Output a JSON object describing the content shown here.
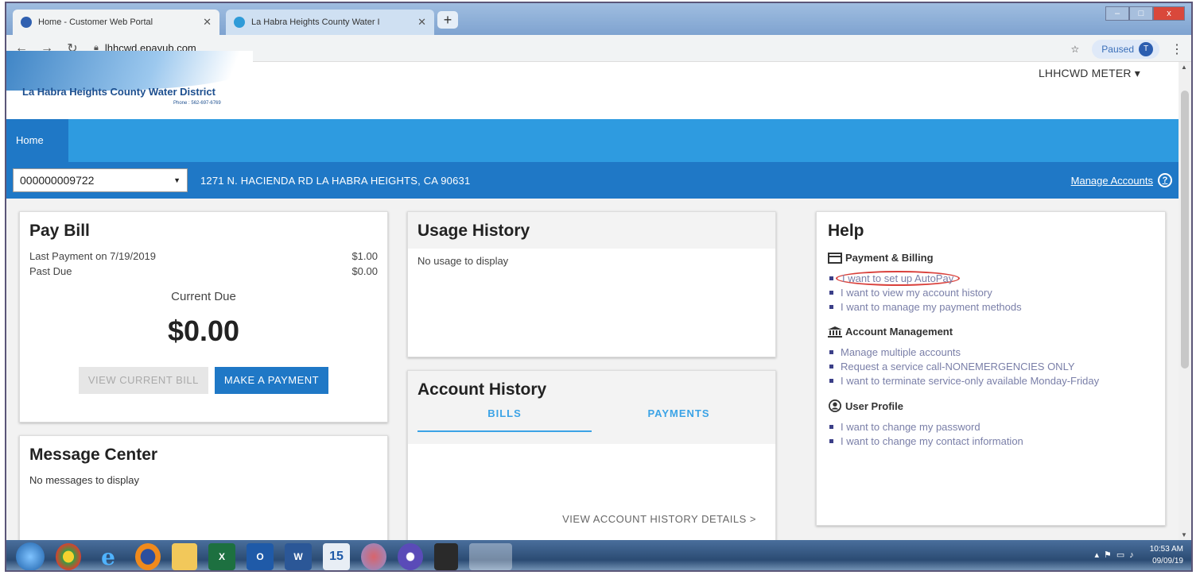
{
  "browser": {
    "tabs": [
      {
        "title": "Home - Customer Web Portal",
        "active": true
      },
      {
        "title": "La Habra Heights County Water I",
        "active": false
      }
    ],
    "new_tab": "+",
    "url": "lhhcwd.epayub.com",
    "profile_status": "Paused",
    "profile_initial": "T",
    "window_buttons": {
      "minimize": "–",
      "maximize": "□",
      "close": "x"
    }
  },
  "header": {
    "logo_title": "La Habra Heights County Water District",
    "logo_phone": "Phone : 562-697-6769",
    "user_menu": "LHHCWD METER ▾"
  },
  "nav": {
    "home": "Home"
  },
  "account_bar": {
    "account_number": "000000009722",
    "address": "1271 N. HACIENDA RD LA HABRA HEIGHTS, CA 90631",
    "manage_accounts": "Manage Accounts"
  },
  "pay_bill": {
    "title": "Pay Bill",
    "last_payment_label": "Last Payment on 7/19/2019",
    "last_payment_amount": "$1.00",
    "past_due_label": "Past Due",
    "past_due_amount": "$0.00",
    "current_due_label": "Current Due",
    "current_due_amount": "$0.00",
    "view_bill_button": "VIEW CURRENT BILL",
    "make_payment_button": "MAKE A PAYMENT"
  },
  "message_center": {
    "title": "Message Center",
    "empty": "No messages to display"
  },
  "usage_history": {
    "title": "Usage History",
    "empty": "No usage to display"
  },
  "account_history": {
    "title": "Account History",
    "tabs": [
      "BILLS",
      "PAYMENTS"
    ],
    "details_link": "VIEW ACCOUNT HISTORY DETAILS >"
  },
  "help": {
    "title": "Help",
    "sections": [
      {
        "heading": "Payment & Billing",
        "icon": "credit-card-icon",
        "items": [
          "I want to set up AutoPay",
          "I want to view my account history",
          "I want to manage my payment methods"
        ]
      },
      {
        "heading": "Account Management",
        "icon": "bank-icon",
        "items": [
          "Manage multiple accounts",
          "Request a service call-NONEMERGENCIES ONLY",
          "I want to terminate service-only available Monday-Friday"
        ]
      },
      {
        "heading": "User Profile",
        "icon": "user-circle-icon",
        "items": [
          "I want to change my password",
          "I want to change my contact information"
        ]
      }
    ]
  },
  "taskbar": {
    "time": "10:53 AM",
    "date": "09/09/19",
    "icons": [
      "windows-start-icon",
      "chrome-icon",
      "internet-explorer-icon",
      "firefox-icon",
      "file-explorer-icon",
      "excel-icon",
      "outlook-icon",
      "word-icon",
      "calendar-icon",
      "paint-icon",
      "ums-icon",
      "acrobat-icon",
      "chrome-active-icon"
    ]
  },
  "colors": {
    "nav_blue": "#2e9be0",
    "account_bar_blue": "#1f78c6",
    "link_blue": "#3ba3e6",
    "autopay_highlight": "#d9403b"
  }
}
